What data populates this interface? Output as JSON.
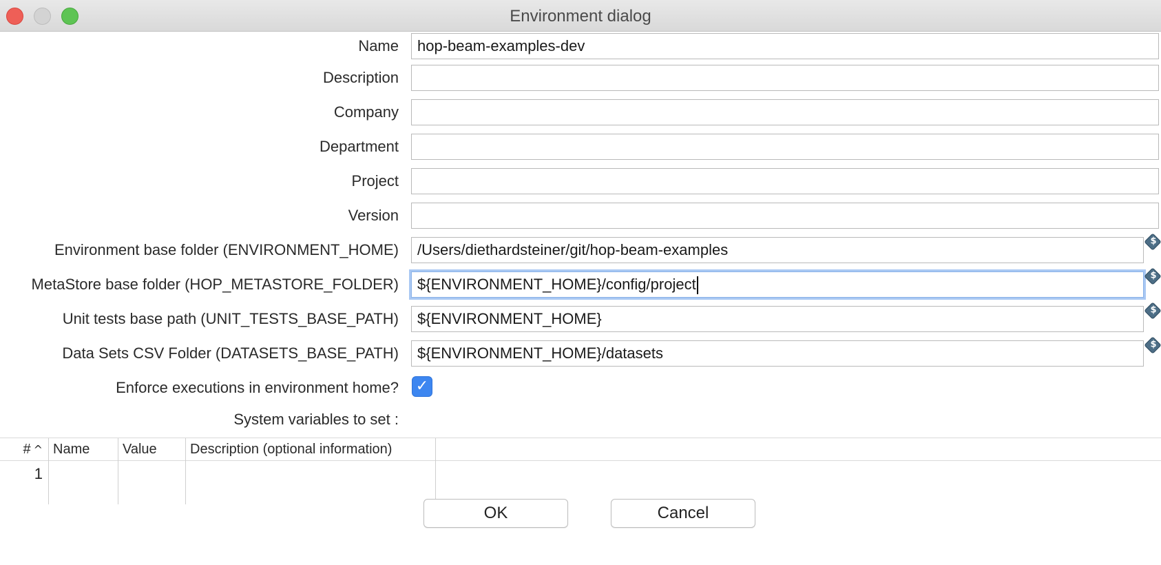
{
  "window": {
    "title": "Environment dialog"
  },
  "fields": {
    "name": {
      "label": "Name",
      "value": "hop-beam-examples-dev"
    },
    "description": {
      "label": "Description",
      "value": ""
    },
    "company": {
      "label": "Company",
      "value": ""
    },
    "department": {
      "label": "Department",
      "value": ""
    },
    "project": {
      "label": "Project",
      "value": ""
    },
    "version": {
      "label": "Version",
      "value": ""
    },
    "environment_home": {
      "label": "Environment base folder (ENVIRONMENT_HOME)",
      "value": "/Users/diethardsteiner/git/hop-beam-examples"
    },
    "metastore_folder": {
      "label": "MetaStore base folder (HOP_METASTORE_FOLDER)",
      "value": "${ENVIRONMENT_HOME}/config/project"
    },
    "unit_tests_path": {
      "label": "Unit tests base path (UNIT_TESTS_BASE_PATH)",
      "value": "${ENVIRONMENT_HOME}"
    },
    "datasets_path": {
      "label": "Data Sets CSV Folder (DATASETS_BASE_PATH)",
      "value": "${ENVIRONMENT_HOME}/datasets"
    }
  },
  "enforce": {
    "label": "Enforce executions in environment home?",
    "checked": true,
    "check_glyph": "✓"
  },
  "variables": {
    "label": "System variables to set :",
    "columns": {
      "num": "#",
      "name": "Name",
      "value": "Value",
      "description": "Description (optional information)"
    },
    "sort_icon": "chevron-up-icon",
    "sort_glyph": "^",
    "rows": [
      {
        "num": "1",
        "name": "",
        "value": "",
        "description": ""
      }
    ]
  },
  "variable_icon_glyph": "$",
  "buttons": {
    "ok": "OK",
    "cancel": "Cancel"
  }
}
